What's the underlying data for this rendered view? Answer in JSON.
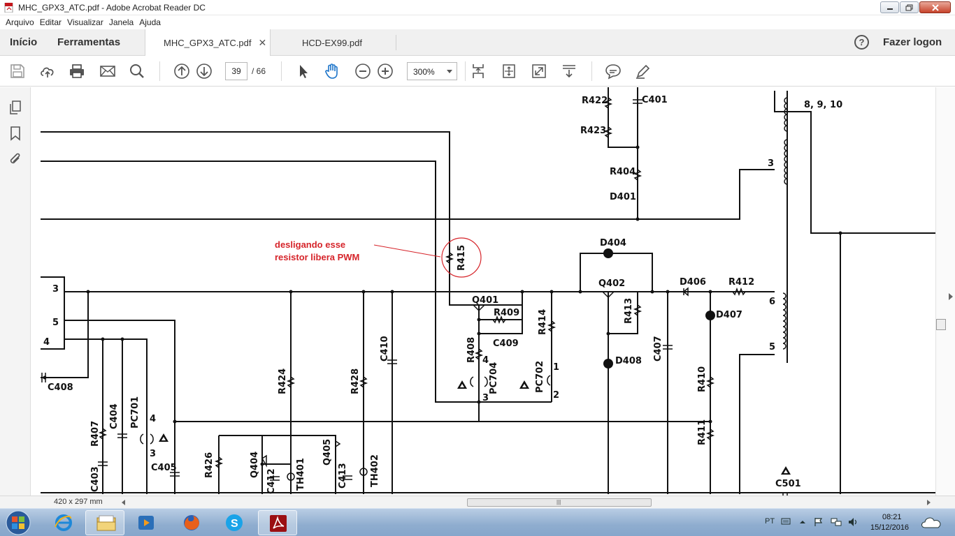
{
  "window": {
    "title": "MHC_GPX3_ATC.pdf - Adobe Acrobat Reader DC"
  },
  "menu": [
    "Arquivo",
    "Editar",
    "Visualizar",
    "Janela",
    "Ajuda"
  ],
  "tabs": {
    "home": "Início",
    "tools": "Ferramentas",
    "docs": [
      {
        "label": "MHC_GPX3_ATC.pdf",
        "active": true
      },
      {
        "label": "HCD-EX99.pdf",
        "active": false
      }
    ],
    "login": "Fazer logon",
    "help_glyph": "?"
  },
  "toolbar": {
    "page_current": "39",
    "page_total": "/ 66",
    "zoom": "300%"
  },
  "annotation": {
    "line1": "desligando esse",
    "line2": "resistor libera PWM",
    "color": "#d6242a"
  },
  "schematic_labels": {
    "R422": "R422",
    "C401": "C401",
    "R423": "R423",
    "R404": "R404",
    "D401": "D401",
    "T": "8, 9, 10",
    "pin3a": "3",
    "R415": "R415",
    "D404": "D404",
    "Q402": "Q402",
    "D406": "D406",
    "R412": "R412",
    "Q401": "Q401",
    "R409": "R409",
    "C409": "C409",
    "R414": "R414",
    "R408": "R408",
    "PC704": "PC704",
    "PC702": "PC702",
    "R413": "R413",
    "D407": "D407",
    "D408": "D408",
    "C407": "C407",
    "C410": "C410",
    "R410": "R410",
    "R411": "R411",
    "C408": "C408",
    "R424": "R424",
    "R428": "R428",
    "R407": "R407",
    "C404": "C404",
    "PC701": "PC701",
    "C403": "C403",
    "C405": "C405",
    "R426": "R426",
    "Q404": "Q404",
    "C412": "C412",
    "TH401": "TH401",
    "Q405": "Q405",
    "C413": "C413",
    "TH402": "TH402",
    "C501": "C501",
    "p3": "3",
    "p5a": "5",
    "p4a": "4",
    "p4b": "4",
    "p3b": "3",
    "p4c": "4",
    "p3c": "3",
    "p1": "1",
    "p2": "2",
    "p6": "6",
    "p5b": "5"
  },
  "status": {
    "page_size": "420 x 297 mm"
  },
  "taskbar": {
    "lang": "PT",
    "time": "08:21",
    "date": "15/12/2016"
  }
}
